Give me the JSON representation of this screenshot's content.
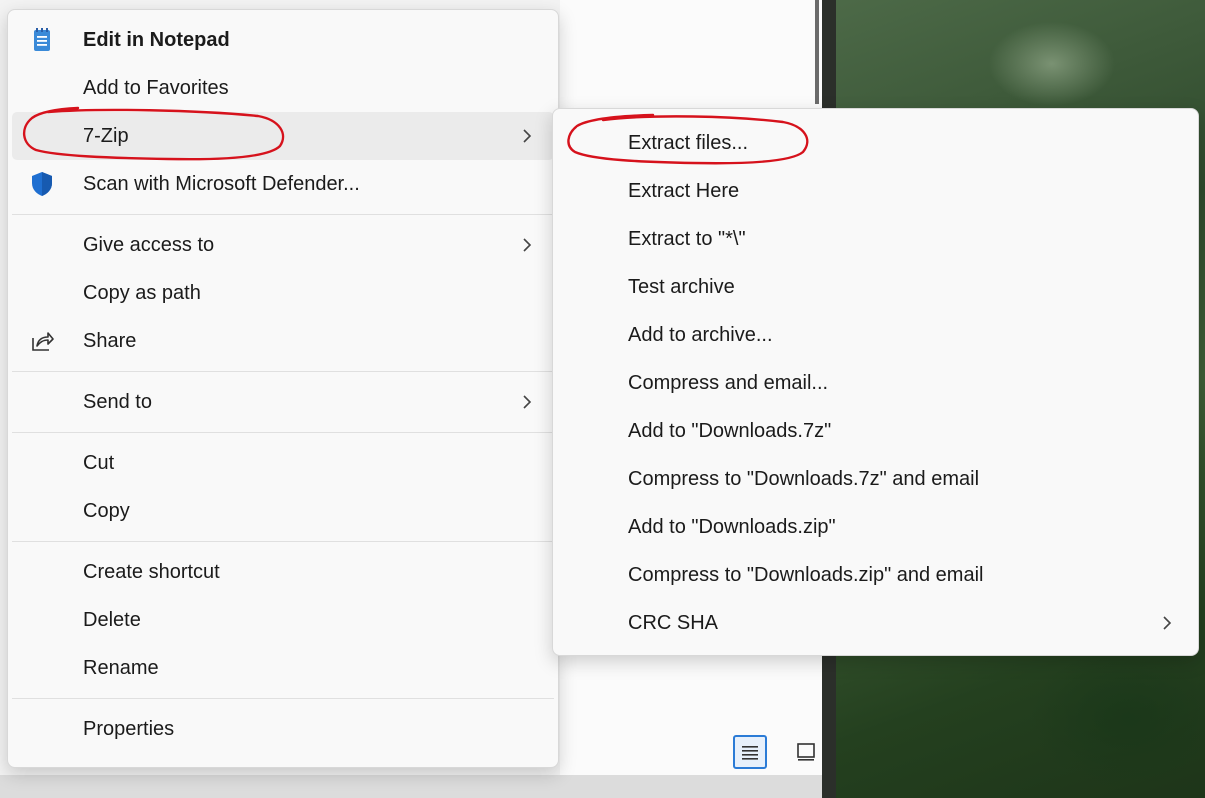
{
  "main_menu": {
    "items": [
      {
        "label": "Edit in Notepad",
        "bold": true,
        "icon": "notepad-icon"
      },
      {
        "label": "Add to Favorites"
      },
      {
        "label": "7-Zip",
        "submenu": true,
        "highlighted": true
      },
      {
        "label": "Scan with Microsoft Defender...",
        "icon": "defender-shield-icon"
      },
      {
        "label": "Give access to",
        "submenu": true
      },
      {
        "label": "Copy as path"
      },
      {
        "label": "Share",
        "icon": "share-icon"
      },
      {
        "label": "Send to",
        "submenu": true
      },
      {
        "label": "Cut"
      },
      {
        "label": "Copy"
      },
      {
        "label": "Create shortcut"
      },
      {
        "label": "Delete"
      },
      {
        "label": "Rename"
      },
      {
        "label": "Properties"
      }
    ]
  },
  "sub_menu": {
    "items": [
      {
        "label": "Extract files..."
      },
      {
        "label": "Extract Here"
      },
      {
        "label": "Extract to \"*\\\""
      },
      {
        "label": "Test archive"
      },
      {
        "label": "Add to archive..."
      },
      {
        "label": "Compress and email..."
      },
      {
        "label": "Add to \"Downloads.7z\""
      },
      {
        "label": "Compress to \"Downloads.7z\" and email"
      },
      {
        "label": "Add to \"Downloads.zip\""
      },
      {
        "label": "Compress to \"Downloads.zip\" and email"
      },
      {
        "label": "CRC SHA",
        "submenu": true
      }
    ]
  },
  "colors": {
    "annotation": "#d6121c",
    "accent": "#2b7bd6",
    "defender_blue": "#1f6fd1",
    "notepad_blue": "#3a8ad8"
  },
  "view_buttons": {
    "details_icon": "details-view-icon",
    "tiles_icon": "tiles-view-icon"
  }
}
